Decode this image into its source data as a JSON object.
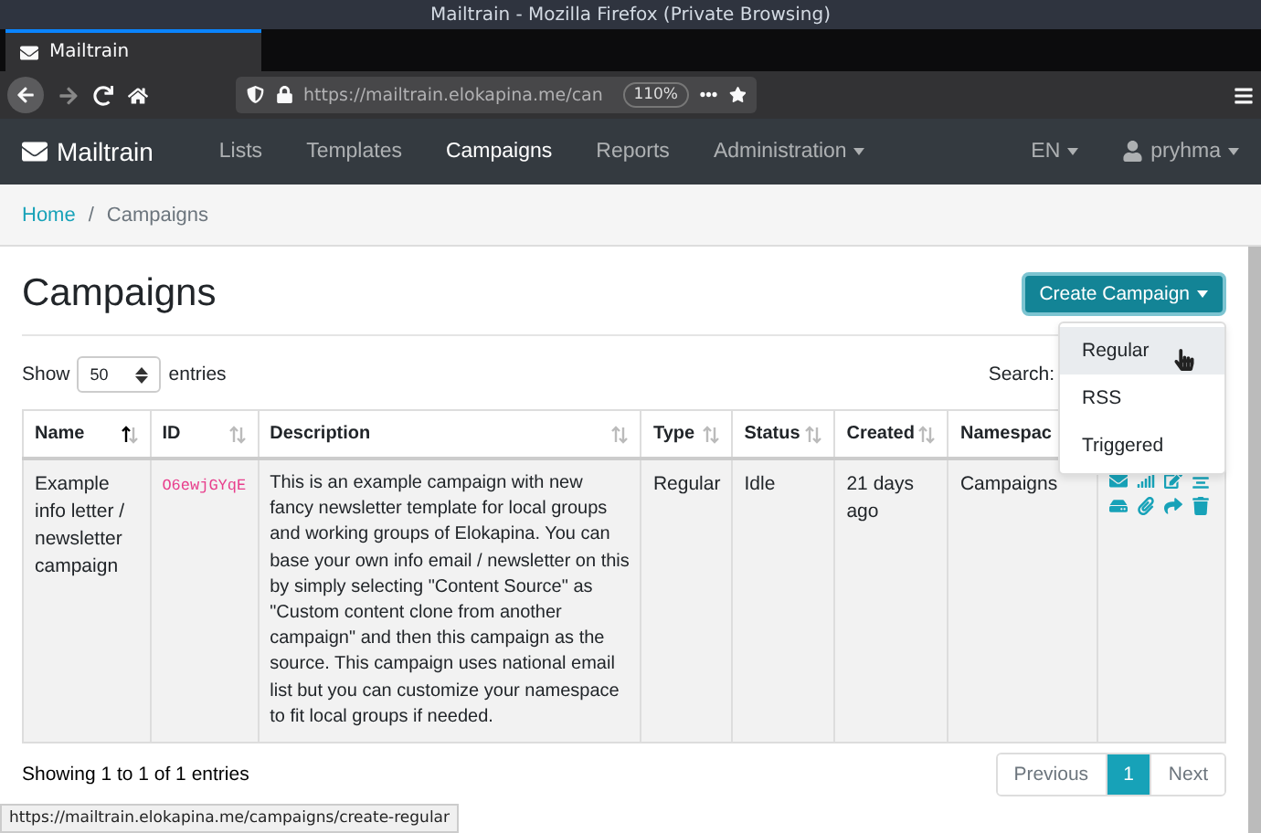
{
  "browser": {
    "window_title": "Mailtrain - Mozilla Firefox (Private Browsing)",
    "tabs": [
      {
        "label": "Mailtrain",
        "selected": true
      }
    ],
    "url_host": "https://mailtrain.elokapina.me/can",
    "zoom": "110%",
    "status_link": "https://mailtrain.elokapina.me/campaigns/create-regular"
  },
  "navbar": {
    "brand": "Mailtrain",
    "items": [
      {
        "label": "Lists",
        "selected": false,
        "dropdown": false
      },
      {
        "label": "Templates",
        "selected": false,
        "dropdown": false
      },
      {
        "label": "Campaigns",
        "selected": true,
        "dropdown": false
      },
      {
        "label": "Reports",
        "selected": false,
        "dropdown": false
      },
      {
        "label": "Administration",
        "selected": false,
        "dropdown": true
      }
    ],
    "language": "EN",
    "user": "pryhma"
  },
  "breadcrumb": {
    "separator": "/",
    "items": [
      {
        "label": "Home",
        "kind": "link"
      },
      {
        "label": "Campaigns",
        "kind": "current"
      }
    ]
  },
  "page": {
    "title": "Campaigns",
    "create_button": "Create Campaign",
    "create_menu": [
      {
        "label": "Regular",
        "selected": true
      },
      {
        "label": "RSS",
        "selected": false
      },
      {
        "label": "Triggered",
        "selected": false
      }
    ]
  },
  "table_controls": {
    "show_label": "Show",
    "page_size": "50",
    "entries_label": "entries",
    "search_label": "Search:"
  },
  "table": {
    "columns": [
      {
        "label": "Name",
        "sorted_ascending": true
      },
      {
        "label": "ID",
        "sorted_ascending": false
      },
      {
        "label": "Description",
        "sorted_ascending": false
      },
      {
        "label": "Type",
        "sorted_ascending": false
      },
      {
        "label": "Status",
        "sorted_ascending": false
      },
      {
        "label": "Created",
        "sorted_ascending": false
      },
      {
        "label": "Namespac"
      }
    ],
    "rows": [
      {
        "name": "Example info letter / newsletter campaign",
        "id": "O6ewjGYqE",
        "description": "This is an example campaign with new fancy newsletter template for local groups and working groups of Elokapina. You can base your own info email / newsletter on this by simply selecting \"Content Source\" as \"Custom content clone from another campaign\" and then this campaign as the source. This campaign uses national email list but you can customize your namespace to fit local groups if needed.",
        "type": "Regular",
        "status": "Idle",
        "created": "21 days ago",
        "namespace": "Campaigns"
      }
    ]
  },
  "footer": {
    "info": "Showing 1 to 1 of 1 entries",
    "pagination": [
      {
        "label": "Previous",
        "selected": false
      },
      {
        "label": "1",
        "selected": true
      },
      {
        "label": "Next",
        "selected": false
      }
    ]
  }
}
